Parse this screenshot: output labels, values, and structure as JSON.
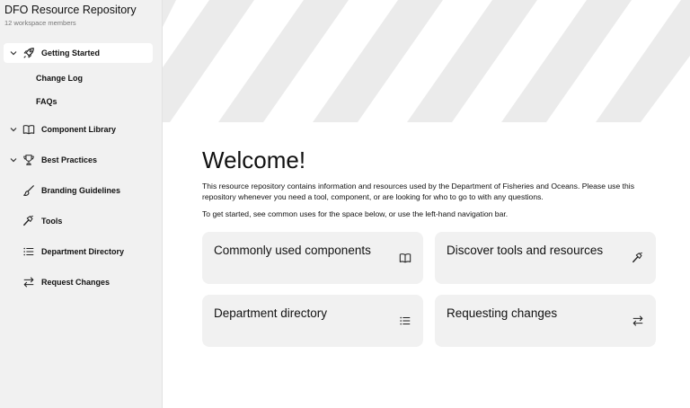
{
  "workspace": {
    "title": "DFO Resource Repository",
    "members": "12 workspace members"
  },
  "sidebar": {
    "items": [
      {
        "label": "Getting Started",
        "icon": "rocket-icon",
        "expandable": true,
        "active": true
      },
      {
        "label": "Component Library",
        "icon": "book-icon",
        "expandable": true
      },
      {
        "label": "Best Practices",
        "icon": "trophy-icon",
        "expandable": true
      },
      {
        "label": "Branding Guidelines",
        "icon": "brush-icon",
        "expandable": false
      },
      {
        "label": "Tools",
        "icon": "hammer-icon",
        "expandable": false
      },
      {
        "label": "Department Directory",
        "icon": "list-icon",
        "expandable": false
      },
      {
        "label": "Request Changes",
        "icon": "swap-arrows-icon",
        "expandable": false
      }
    ],
    "subitems": [
      {
        "label": "Change Log"
      },
      {
        "label": "FAQs"
      }
    ]
  },
  "main": {
    "heading": "Welcome!",
    "intro": "This resource repository contains information and resources used by the Department of Fisheries and Oceans. Please use this repository whenever you need a tool, component, or are looking for who to go to with any questions.",
    "intro2": "To get started, see common uses for the space below, or use the left-hand navigation bar.",
    "cards": [
      {
        "title": "Commonly used components",
        "icon": "book-icon"
      },
      {
        "title": "Discover tools and resources",
        "icon": "hammer-icon"
      },
      {
        "title": "Department directory",
        "icon": "list-icon"
      },
      {
        "title": "Requesting changes",
        "icon": "swap-arrows-icon"
      }
    ]
  },
  "colors": {
    "sidebar_bg": "#f1f1f1",
    "card_bg": "#f1f1f1",
    "stripe": "#ebebeb",
    "text": "#111111"
  }
}
